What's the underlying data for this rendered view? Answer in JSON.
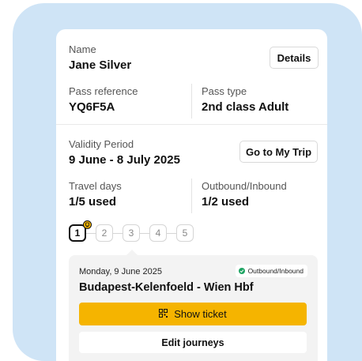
{
  "pass": {
    "name_label": "Name",
    "name_value": "Jane Silver",
    "details_button": "Details",
    "reference_label": "Pass reference",
    "reference_value": "YQ6F5A",
    "type_label": "Pass type",
    "type_value": "2nd class Adult"
  },
  "validity": {
    "label": "Validity Period",
    "value": "9 June - 8 July 2025",
    "trip_button": "Go to My Trip",
    "travel_days_label": "Travel days",
    "travel_days_value": "1/5 used",
    "outbound_label": "Outbound/Inbound",
    "outbound_value": "1/2 used"
  },
  "days": {
    "items": [
      "1",
      "2",
      "3",
      "4",
      "5"
    ],
    "active": 1,
    "badge_icon": "train-icon"
  },
  "journey": {
    "date": "Monday, 9 June 2025",
    "tag": "Outbound/Inbound",
    "tag_icon": "check-circle-icon",
    "route": "Budapest-Kelenfoeld - Wien Hbf",
    "show_ticket": "Show ticket",
    "show_ticket_icon": "qr-code-icon",
    "edit": "Edit journeys"
  },
  "colors": {
    "background_blob": "#cfe4f6",
    "accent": "#f5b400",
    "success": "#1fa463"
  }
}
